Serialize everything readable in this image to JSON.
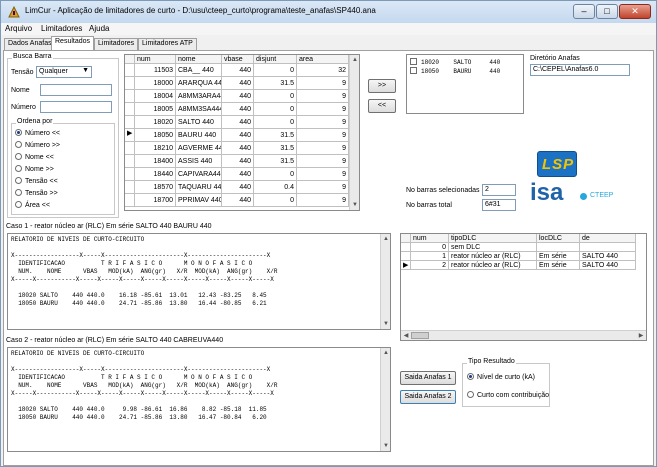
{
  "window": {
    "title": "LimCur - Aplicação de limitadores de curto - D:\\usu\\cteep_curto\\programa\\teste_anafas\\SP440.ana"
  },
  "menu": [
    "Arquivo",
    "Limitadores",
    "Ajuda"
  ],
  "tabs": [
    "Dados Anafas",
    "Resultados",
    "Limitadores",
    "Limitadores ATP"
  ],
  "busca": {
    "title": "Busca Barra",
    "tensao_label": "Tensão",
    "tensao_value": "Qualquer",
    "nome_label": "Nome",
    "numero_label": "Número",
    "ordena_title": "Ordena por",
    "options": [
      "Número <<",
      "Número >>",
      "Nome <<",
      "Nome >>",
      "Tensão <<",
      "Tensão >>",
      "Área <<"
    ]
  },
  "bus_table": {
    "columns": [
      "num",
      "nome",
      "vbase",
      "disjunt",
      "area"
    ],
    "rows": [
      [
        "11503",
        "CBA__ 440",
        "440",
        "0",
        "32"
      ],
      [
        "18000",
        "ARARQUA 44(",
        "440",
        "31.5",
        "9"
      ],
      [
        "18004",
        "A8MM3ARA44",
        "440",
        "0",
        "9"
      ],
      [
        "18005",
        "A8MM3SA444",
        "440",
        "0",
        "9"
      ],
      [
        "18020",
        "SALTO  440",
        "440",
        "0",
        "9"
      ],
      [
        "18050",
        "BAURU  440",
        "440",
        "31.5",
        "9"
      ],
      [
        "18210",
        "AGVERME 44(",
        "440",
        "31.5",
        "9"
      ],
      [
        "18400",
        "ASSIS  440",
        "440",
        "31.5",
        "9"
      ],
      [
        "18440",
        "CAPIVARA440",
        "440",
        "0",
        "9"
      ],
      [
        "18570",
        "TAQUARU 44(",
        "440",
        "0.4",
        "9"
      ],
      [
        "18700",
        "PPRIMAV 440",
        "440",
        "0",
        "9"
      ]
    ],
    "current_row": 5
  },
  "buttons": {
    "add": ">>",
    "remove": "<<",
    "saida1": "Saida Anafas 1",
    "saida2": "Saida Anafas 2"
  },
  "selected": [
    "18020    SALTO     440",
    "18050    BAURU     440"
  ],
  "anafas": {
    "dir_label": "Diretório Anafas",
    "dir_value": "C:\\CEPEL\\Anafas6.0",
    "sel_label": "No barras selecionadas",
    "sel_value": "2",
    "total_label": "No barras total",
    "total_value": "6#31"
  },
  "logos": {
    "lsp": "LSP",
    "isa": "isa",
    "cteep": "CTEEP"
  },
  "caso1": {
    "title": "Caso 1 - reator núcleo ar (RLC) Em série SALTO   440 BAURU   440",
    "text": "RELATORIO DE NIVEIS DE CURTO-CIRCUITO\n\nX------------------X-----X----------------------X----------------------X\n  IDENTIFICACAO          T R I F A S I C O      M O N O F A S I C O\n  NUM.    NOME      VBAS   MOD(kA)  ANG(gr)   X/R  MOD(kA)  ANG(gr)    X/R\nX-----X-----------X-----X-----X-----X-----X-----X-----X-----X-----X-----X\n\n  18020 SALTO    440 440.0    16.18 -85.61  13.01   12.43 -83.25   8.45\n  18050 BAURU    440 440.0    24.71 -85.86  13.80   16.44 -80.85   6.21"
  },
  "caso2": {
    "title": "Caso 2 - reator núcleo ar (RLC) Em série SALTO   440 CABREUVA440",
    "text": "RELATORIO DE NIVEIS DE CURTO-CIRCUITO\n\nX------------------X-----X----------------------X----------------------X\n  IDENTIFICACAO          T R I F A S I C O      M O N O F A S I C O\n  NUM.    NOME      VBAS   MOD(kA)  ANG(gr)   X/R  MOD(kA)  ANG(gr)    X/R\nX-----X-----------X-----X-----X-----X-----X-----X-----X-----X-----X-----X\n\n  18020 SALTO    440 440.0     9.98 -86.61  16.86    8.82 -85.18  11.85\n  18050 BAURU    440 440.0    24.71 -85.86  13.80   16.47 -80.84   6.20"
  },
  "dlc_table": {
    "columns": [
      "num",
      "tipoDLC",
      "locDLC",
      "de"
    ],
    "rows": [
      [
        "0",
        "sem DLC",
        "",
        ""
      ],
      [
        "1",
        "reator núcleo ar (RLC)",
        "Em série",
        "SALTO   440"
      ],
      [
        "2",
        "reator núcleo ar (RLC)",
        "Em série",
        "SALTO   440"
      ]
    ],
    "current_row": 2
  },
  "tipo": {
    "title": "Tipo Resultado",
    "opt1": "Nível de curto (kA)",
    "opt2": "Curto com contribuição"
  }
}
